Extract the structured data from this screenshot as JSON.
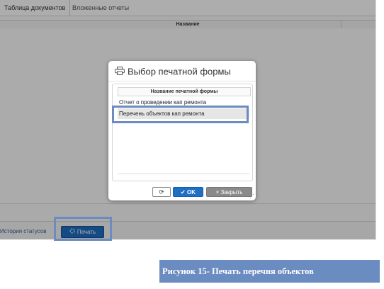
{
  "tabs": [
    {
      "label": "Таблица документов",
      "active": true
    },
    {
      "label": "Вложенные отчеты",
      "active": false
    }
  ],
  "grid": {
    "column_header": "Название"
  },
  "footer": {
    "history_link": "История статусов",
    "print_button": "Печать"
  },
  "dialog": {
    "title": "Выбор печатной формы",
    "list_header": "Название печатной формы",
    "items": [
      {
        "label": "Отчет о проведении кап ремонта",
        "selected": false
      },
      {
        "label": "Перечень объектов кап ремонта",
        "selected": true
      }
    ],
    "buttons": {
      "refresh_glyph": "⟳",
      "ok": "OK",
      "ok_glyph": "✔",
      "close": "Закрыть",
      "close_glyph": "×"
    }
  },
  "caption": "Рисунок 15- Печать перечня объектов",
  "colors": {
    "accent": "#1f6fc4",
    "highlight_frame": "#6b8cc0",
    "close_button": "#8a8a8a"
  },
  "icons": [
    "printer-icon",
    "refresh-icon",
    "check-icon",
    "close-icon",
    "spinner-icon",
    "resize-grip-icon"
  ]
}
